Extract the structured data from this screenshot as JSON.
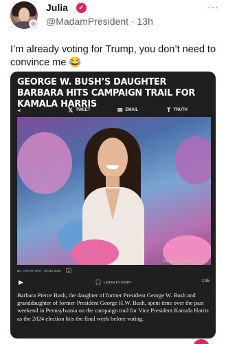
{
  "tweet": {
    "display_name": "Julia",
    "handle": "@MadamPresident",
    "separator": "·",
    "time": "13h",
    "more_icon": "more-dots-icon",
    "text": "I’m already voting for Trump, you don’t need to convince me 😂",
    "colors": {
      "verified": "#e0245e",
      "secondary": "#536471"
    }
  },
  "article": {
    "headline": "GEORGE W. BUSH’S DAUGHTER BARBARA HITS CAMPAIGN TRAIL FOR KAMALA HARRIS",
    "share": {
      "tweet_label": "TWEET",
      "email_label": "EMAIL",
      "truth_label": "TRUTH",
      "tweet_icon": "x-logo-icon",
      "email_icon": "envelope-icon",
      "truth_icon": "truth-social-icon"
    },
    "photo_credit": "Nathan Congleton/NBC via Getty",
    "byline": {
      "prefix": "By",
      "author": "SIMON KENT",
      "date": "29 Oct 2024",
      "comment_count": "3"
    },
    "audio": {
      "listen_label": "LISTEN TO STORY",
      "duration": "1:35",
      "play_icon": "play-icon",
      "headphones_icon": "headphones-icon"
    },
    "body": "Barbara Pierce Bush, the daughter of former President George W. Bush and granddaughter of former President George H.W. Bush, spent time over the past weekend in Pennsylvania on the campaign trail for Vice President Kamala Harris as the 2024 election hits the final week before voting."
  }
}
